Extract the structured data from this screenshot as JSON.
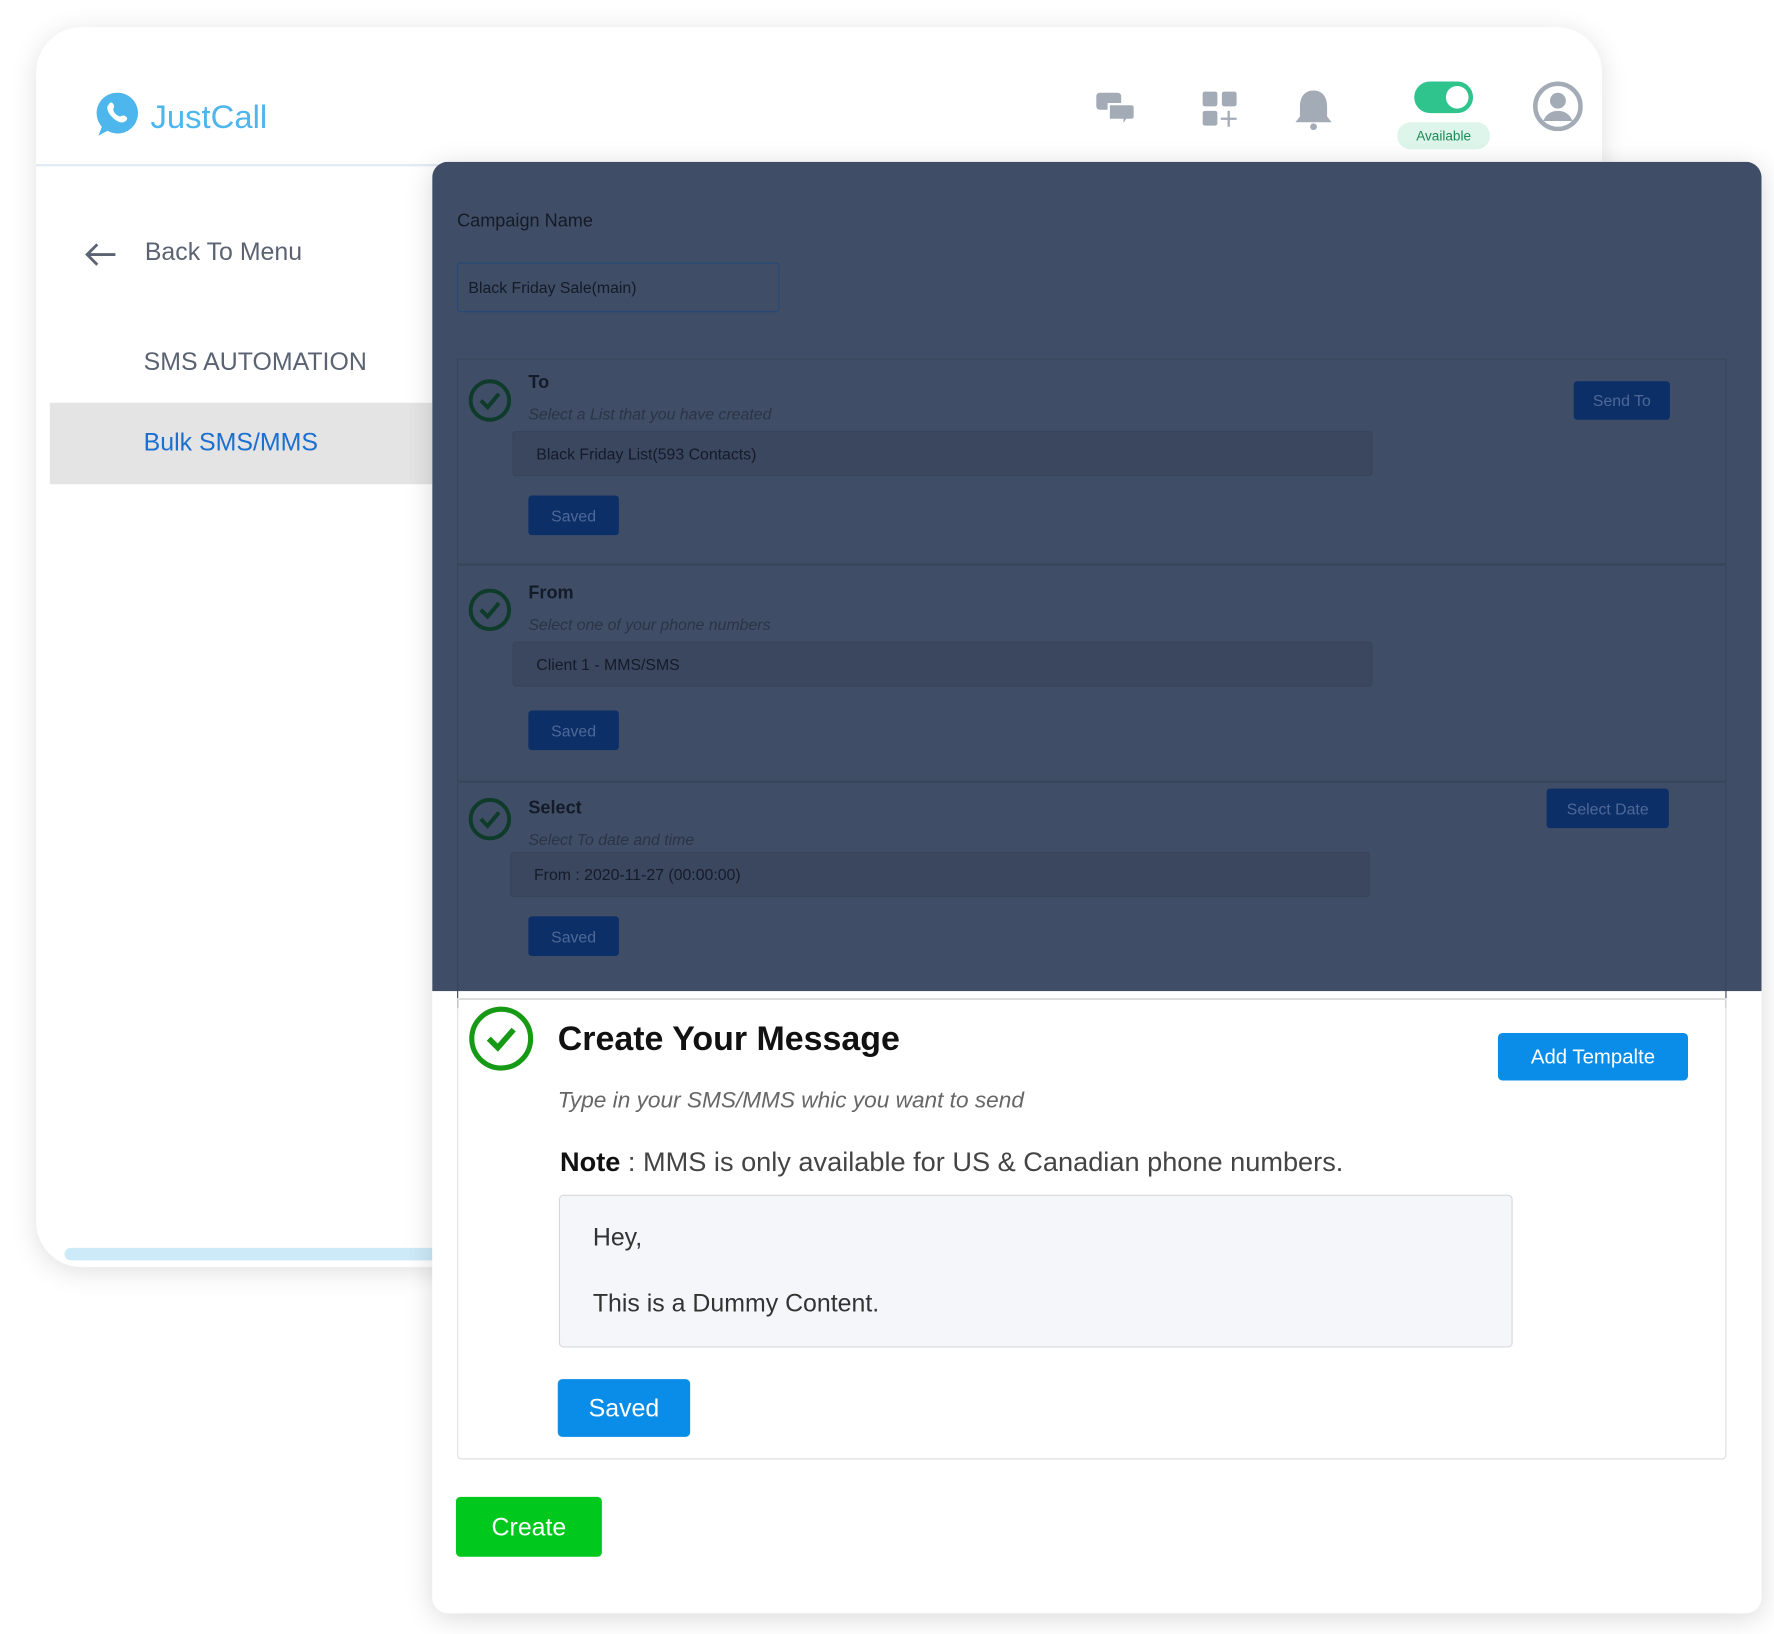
{
  "app": {
    "name": "JustCall",
    "status": "Available",
    "accent": "#4db6ec",
    "status_color": "#2fc48d"
  },
  "header_icons": [
    "chat-icon",
    "apps-add-icon",
    "bell-icon",
    "availability-toggle",
    "avatar-icon"
  ],
  "sidebar": {
    "back": "Back To Menu",
    "section": "SMS AUTOMATION",
    "items": [
      {
        "label": "Bulk SMS/MMS",
        "active": true
      }
    ]
  },
  "form": {
    "campaign_label": "Campaign Name",
    "campaign_value": "Black Friday Sale(main)",
    "steps": [
      {
        "title": "To",
        "subtitle": "Select a List that you have created",
        "value": "Black Friday List(593 Contacts)",
        "saved": "Saved",
        "action": "Send To"
      },
      {
        "title": "From",
        "subtitle": "Select one of your phone numbers",
        "value": "Client 1 - MMS/SMS",
        "saved": "Saved"
      },
      {
        "title": "Select",
        "subtitle": "Select To date and time",
        "value": "From :  2020-11-27 (00:00:00)",
        "saved": "Saved",
        "action": "Select Date"
      }
    ],
    "message": {
      "title": "Create Your Message",
      "subtitle": "Type in your SMS/MMS whic you want to send",
      "note_label": "Note",
      "note_text": " : MMS is only available for US & Canadian phone numbers.",
      "line1": "Hey,",
      "line2": "This is a Dummy Content.",
      "saved": "Saved",
      "template": "Add Tempalte"
    },
    "create": "Create"
  }
}
